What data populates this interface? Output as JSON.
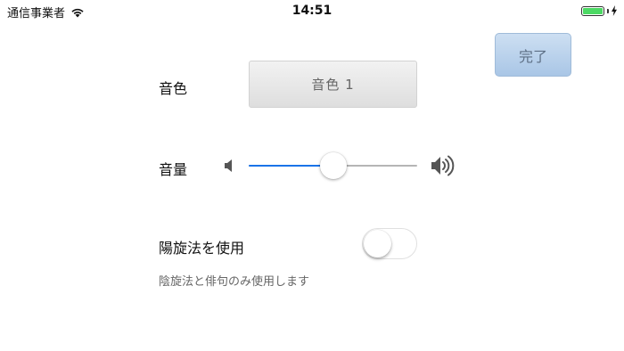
{
  "status_bar": {
    "carrier": "通信事業者",
    "time": "14:51",
    "wifi_icon": "wifi-icon",
    "battery_icon": "battery-icon",
    "charging_icon": "bolt-icon",
    "battery_level": 1.0,
    "battery_color": "#4cd964"
  },
  "header": {
    "done_label": "完了",
    "done_color": "#a9c6e6"
  },
  "timbre": {
    "label": "音色",
    "value": "音色 1"
  },
  "volume": {
    "label": "音量",
    "level": 0.5,
    "min_icon": "speaker-low-icon",
    "max_icon": "speaker-high-icon",
    "track_color": "#1a73e8"
  },
  "yang_mode": {
    "label": "陽旋法を使用",
    "enabled": false,
    "description": "陰旋法と俳句のみ使用します"
  }
}
